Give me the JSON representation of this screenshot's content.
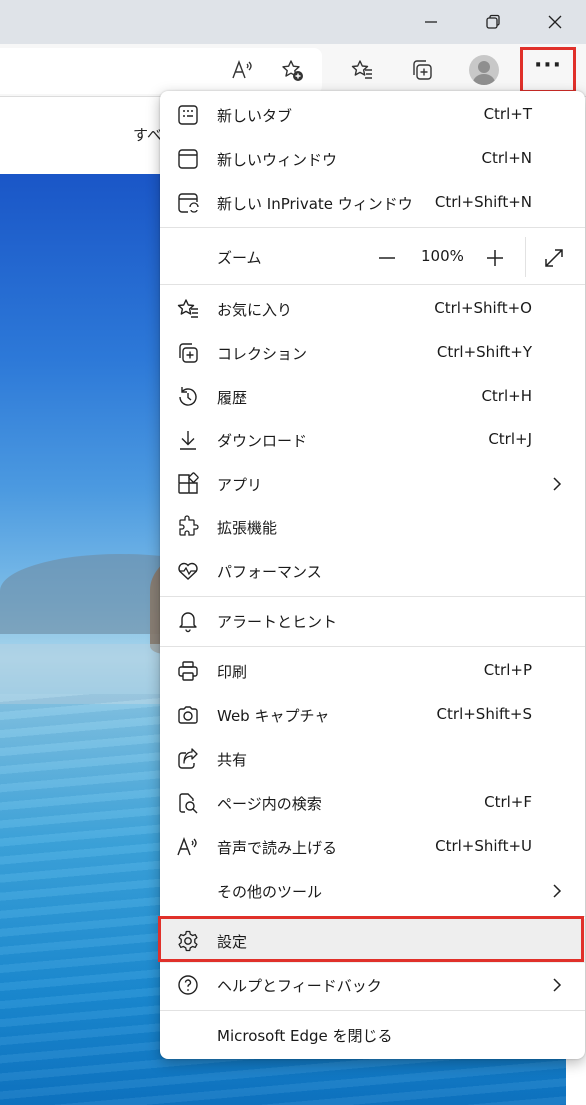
{
  "page": {
    "tab_text": "すべ"
  },
  "toolbar": {
    "read_aloud_icon": "read-aloud-icon",
    "add_favorite_icon": "add-favorite-icon",
    "favorites_icon": "favorites-icon",
    "collections_icon": "collections-icon",
    "profile_icon": "profile-avatar",
    "more_icon": "more-icon",
    "more_label": "···"
  },
  "menu": {
    "new_tab": {
      "label": "新しいタブ",
      "shortcut": "Ctrl+T"
    },
    "new_window": {
      "label": "新しいウィンドウ",
      "shortcut": "Ctrl+N"
    },
    "new_inprivate": {
      "label": "新しい InPrivate ウィンドウ",
      "shortcut": "Ctrl+Shift+N"
    },
    "zoom": {
      "label": "ズーム",
      "value": "100%"
    },
    "favorites": {
      "label": "お気に入り",
      "shortcut": "Ctrl+Shift+O"
    },
    "collections": {
      "label": "コレクション",
      "shortcut": "Ctrl+Shift+Y"
    },
    "history": {
      "label": "履歴",
      "shortcut": "Ctrl+H"
    },
    "downloads": {
      "label": "ダウンロード",
      "shortcut": "Ctrl+J"
    },
    "apps": {
      "label": "アプリ"
    },
    "extensions": {
      "label": "拡張機能"
    },
    "performance": {
      "label": "パフォーマンス"
    },
    "alerts": {
      "label": "アラートとヒント"
    },
    "print": {
      "label": "印刷",
      "shortcut": "Ctrl+P"
    },
    "web_capture": {
      "label": "Web キャプチャ",
      "shortcut": "Ctrl+Shift+S"
    },
    "share": {
      "label": "共有"
    },
    "find": {
      "label": "ページ内の検索",
      "shortcut": "Ctrl+F"
    },
    "read_aloud": {
      "label": "音声で読み上げる",
      "shortcut": "Ctrl+Shift+U"
    },
    "more_tools": {
      "label": "その他のツール"
    },
    "settings": {
      "label": "設定"
    },
    "help": {
      "label": "ヘルプとフィードバック"
    },
    "close_edge": {
      "label": "Microsoft Edge を閉じる"
    }
  },
  "colors": {
    "highlight": "#e0302a",
    "titlebar": "#dfe3e8",
    "toolbar": "#f7f7f7"
  }
}
